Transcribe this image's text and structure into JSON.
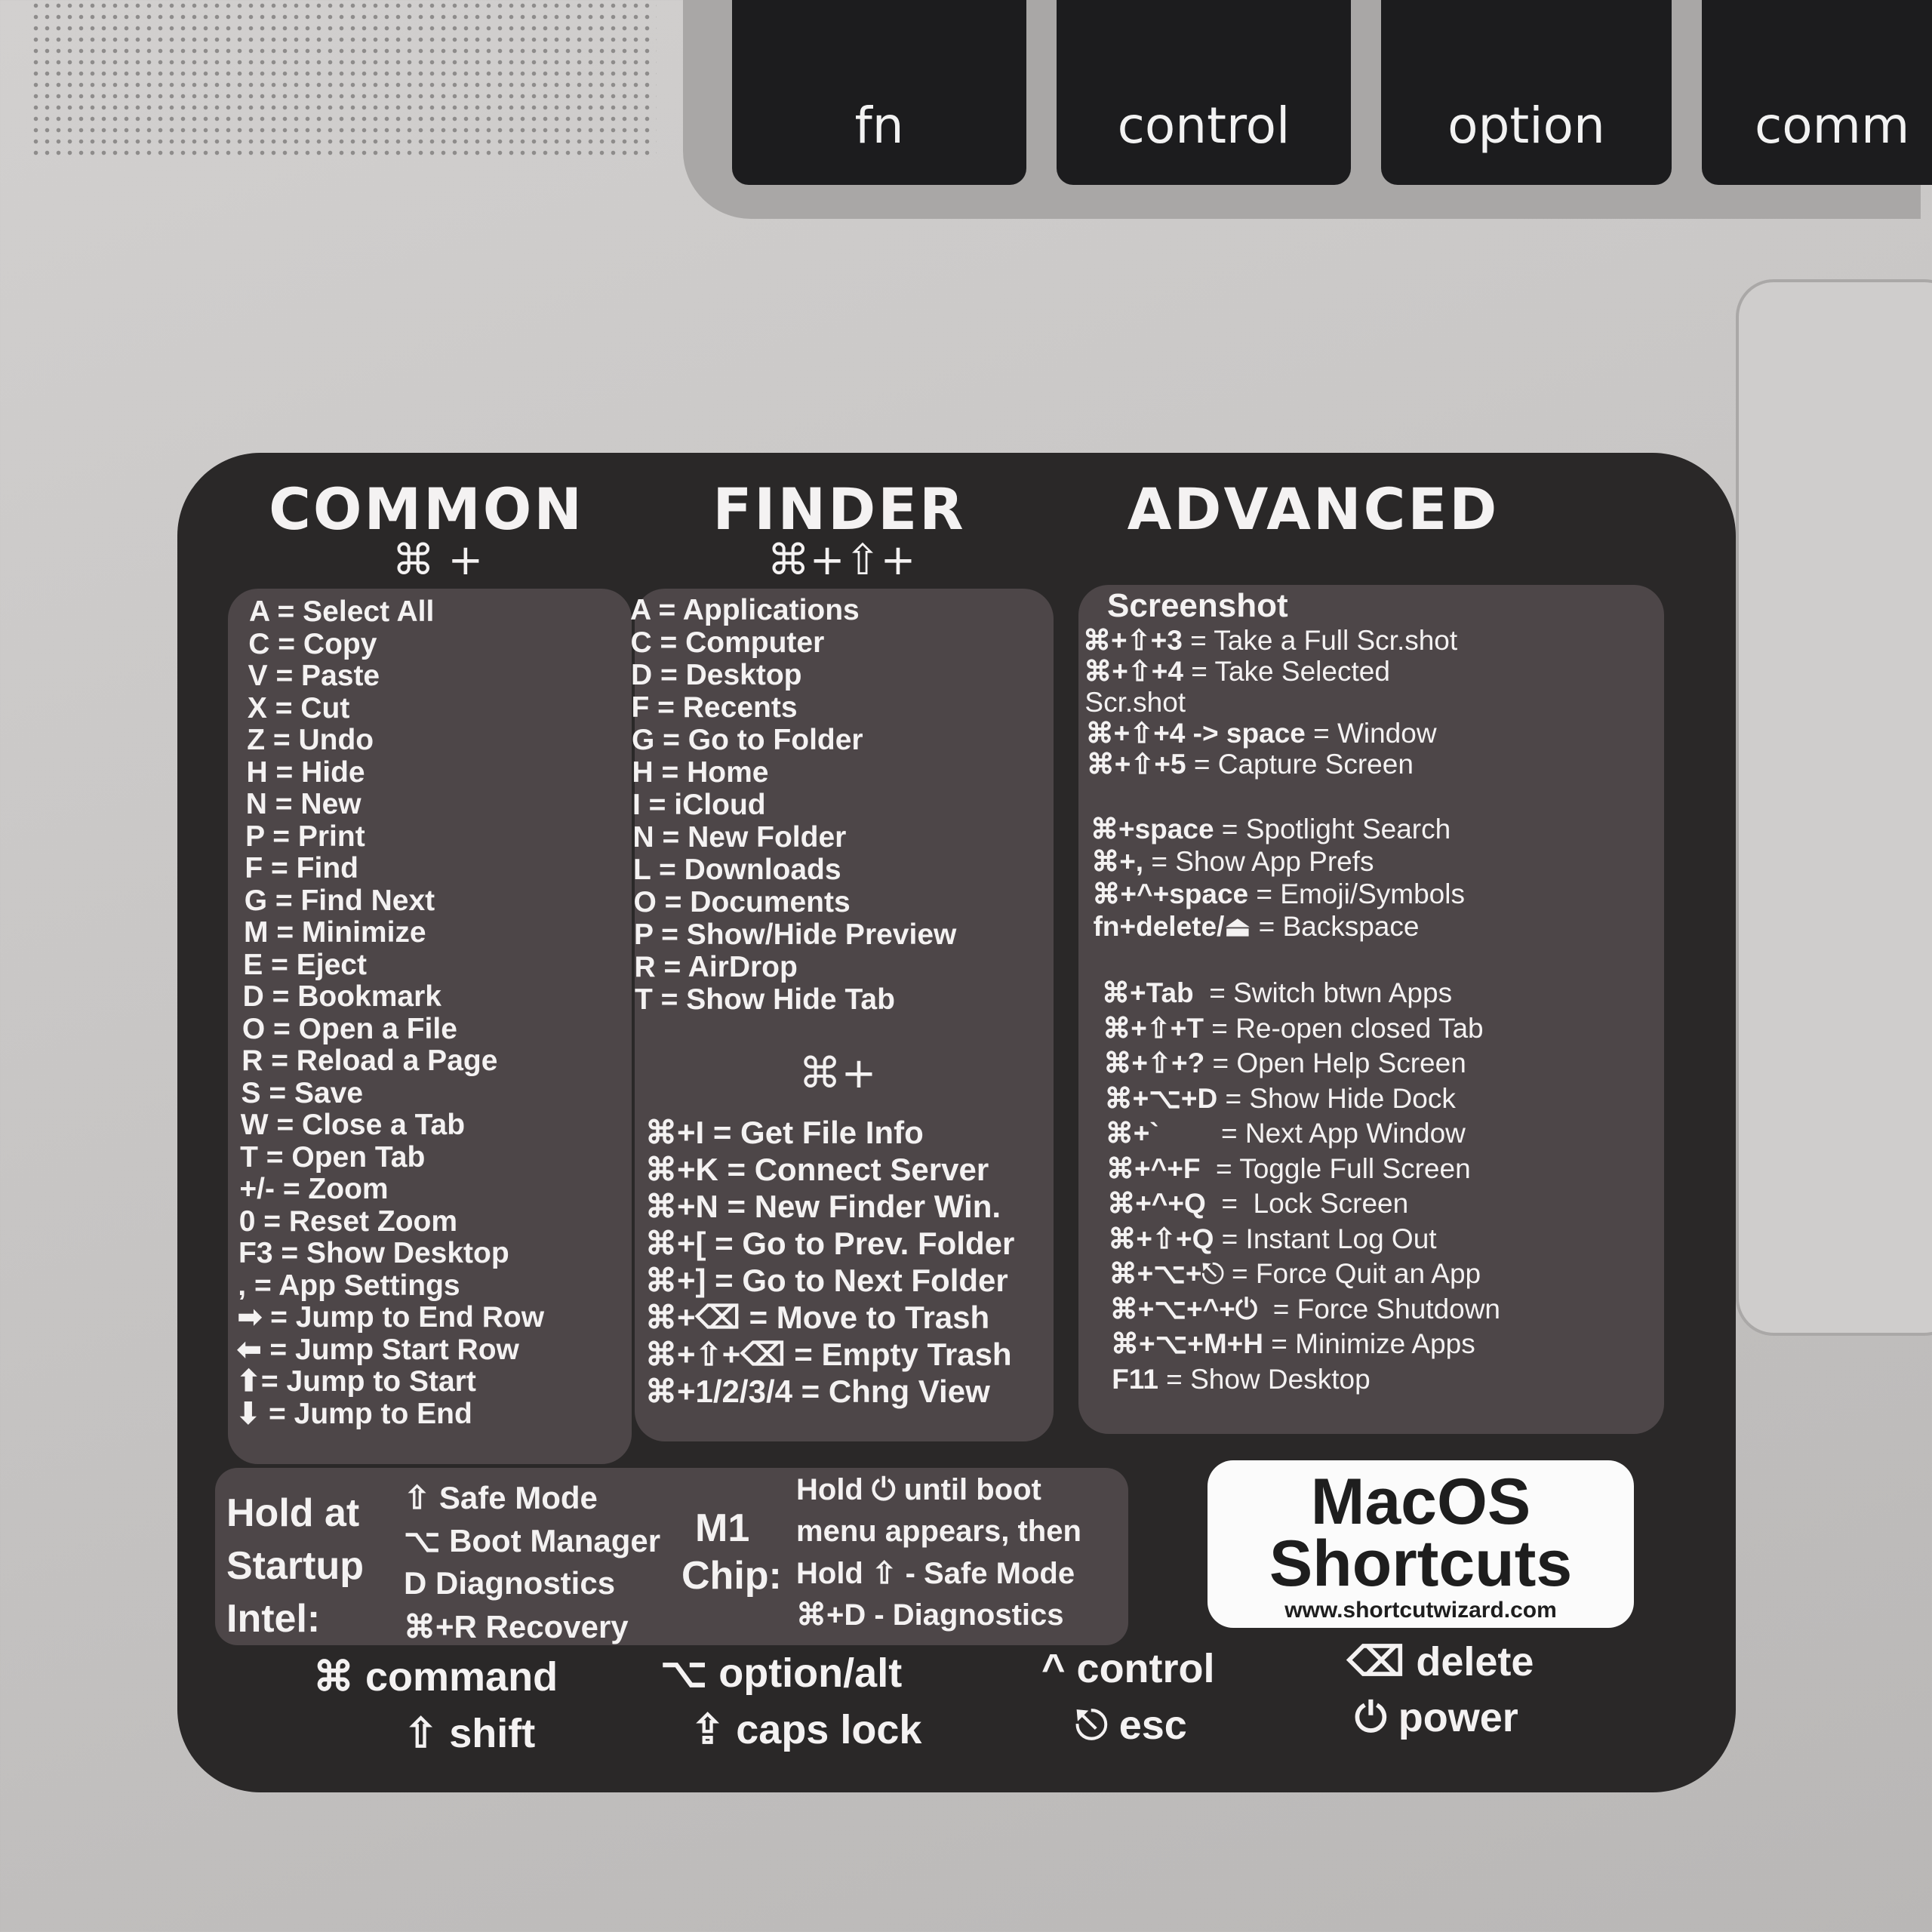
{
  "keyboard": {
    "keys": [
      "fn",
      "control",
      "option",
      "comm"
    ]
  },
  "sticker": {
    "headers": {
      "common": "COMMON",
      "finder": "FINDER",
      "advanced": "ADVANCED"
    },
    "common_prefix": "⌘ +",
    "finder_prefix": "⌘+⇧+",
    "common": [
      "A = Select All",
      "C = Copy",
      "V = Paste",
      "X = Cut",
      "Z = Undo",
      "H = Hide",
      "N = New",
      "P = Print",
      "F = Find",
      "G = Find Next",
      "M = Minimize",
      "E = Eject",
      "D = Bookmark",
      "O = Open a File",
      "R = Reload a Page",
      "S = Save",
      "W = Close a Tab",
      "T = Open Tab",
      "+/- = Zoom",
      "0 = Reset Zoom",
      "F3 = Show Desktop",
      ", = App Settings",
      "➡ = Jump to End Row",
      "⬅ = Jump Start Row",
      "⬆= Jump to Start",
      "⬇ = Jump to End"
    ],
    "finder": [
      "A = Applications",
      "C = Computer",
      "D = Desktop",
      "F = Recents",
      "G = Go to Folder",
      "H = Home",
      "I = iCloud",
      "N = New Folder",
      "L = Downloads",
      "O = Documents",
      "P = Show/Hide Preview",
      "R = AirDrop",
      "T = Show Hide Tab"
    ],
    "finder_cmd_prefix": "⌘+",
    "finder_cmd": [
      "⌘+I = Get File Info",
      "⌘+K = Connect Server",
      "⌘+N = New Finder Win.",
      "⌘+[ = Go to Prev. Folder",
      "⌘+] = Go to Next Folder",
      "⌘+⌫ = Move to Trash",
      "⌘+⇧+⌫ = Empty Trash",
      "⌘+1/2/3/4 = Chng View"
    ],
    "advanced": {
      "screenshot_title": "Screenshot",
      "group1": [
        {
          "k": "⌘+⇧+3",
          "v": " = Take a Full Scr.shot"
        },
        {
          "k": "⌘+⇧+4",
          "v": " = Take Selected"
        },
        {
          "k": "",
          "v": "Scr.shot"
        },
        {
          "k": "⌘+⇧+4 -> space",
          "v": " = Window"
        },
        {
          "k": "⌘+⇧+5",
          "v": " = Capture Screen"
        }
      ],
      "group2": [
        {
          "k": "⌘+space",
          "v": " = Spotlight Search"
        },
        {
          "k": "⌘+,",
          "v": " = Show App Prefs"
        },
        {
          "k": "⌘+^+space",
          "v": " = Emoji/Symbols"
        },
        {
          "k": "fn+delete/⏏",
          "v": " = Backspace"
        }
      ],
      "group3": [
        {
          "k": "⌘+Tab",
          "v": "  = Switch btwn Apps"
        },
        {
          "k": "⌘+⇧+T",
          "v": " = Re-open closed Tab"
        },
        {
          "k": "⌘+⇧+?",
          "v": " = Open Help Screen"
        },
        {
          "k": "⌘+⌥+D",
          "v": " = Show Hide Dock"
        },
        {
          "k": "⌘+`",
          "v": "        = Next App Window"
        },
        {
          "k": "⌘+^+F",
          "v": "  = Toggle Full Screen"
        },
        {
          "k": "⌘+^+Q",
          "v": "  =  Lock Screen"
        },
        {
          "k": "⌘+⇧+Q",
          "v": " = Instant Log Out"
        },
        {
          "k": "⌘+⌥+⎋",
          "v": " = Force Quit an App"
        },
        {
          "k": "⌘+⌥+^+⏻",
          "v": "  = Force Shutdown"
        },
        {
          "k": "⌘+⌥+M+H",
          "v": " = Minimize Apps"
        },
        {
          "k": "F11",
          "v": " = Show Desktop"
        }
      ]
    },
    "boot": {
      "intel_label": [
        "Hold at",
        "Startup",
        "Intel:"
      ],
      "intel_items": [
        "⇧ Safe Mode",
        "⌥ Boot Manager",
        "D  Diagnostics",
        "⌘+R Recovery"
      ],
      "m1_label": [
        "M1",
        "Chip:"
      ],
      "m1_items": [
        "Hold  ⏻  until boot",
        "menu appears, then",
        "Hold ⇧ - Safe Mode",
        "⌘+D - Diagnostics"
      ]
    },
    "logo": {
      "line1": "MacOS",
      "line2": "Shortcuts",
      "url": "www.shortcutwizard.com"
    },
    "legend": [
      "⌘ command",
      "⇧ shift",
      "⌥ option/alt",
      "⇪ caps lock",
      "^ control",
      "⎋ esc",
      "⌫ delete",
      "⏻ power"
    ]
  }
}
